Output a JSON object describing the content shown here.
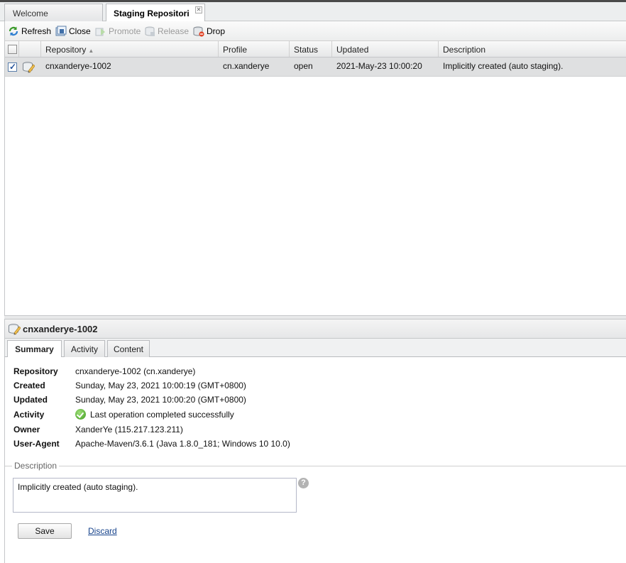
{
  "tabs": [
    {
      "label": "Welcome",
      "active": false
    },
    {
      "label": "Staging Repositori",
      "active": true
    }
  ],
  "toolbar": {
    "refresh": "Refresh",
    "close": "Close",
    "promote": "Promote",
    "release": "Release",
    "drop": "Drop"
  },
  "grid": {
    "columns": [
      "Repository",
      "Profile",
      "Status",
      "Updated",
      "Description"
    ],
    "sort_column": "Repository",
    "sort_direction": "ascending",
    "rows": [
      {
        "selected": true,
        "repository": "cnxanderye-1002",
        "profile": "cn.xanderye",
        "status": "open",
        "updated": "2021-May-23 10:00:20",
        "description": "Implicitly created (auto staging)."
      }
    ]
  },
  "detail": {
    "title": "cnxanderye-1002",
    "subtabs": [
      "Summary",
      "Activity",
      "Content"
    ],
    "active_subtab": "Summary",
    "properties": [
      {
        "label": "Repository",
        "value": "cnxanderye-1002 (cn.xanderye)"
      },
      {
        "label": "Created",
        "value": "Sunday, May 23, 2021 10:00:19 (GMT+0800)"
      },
      {
        "label": "Updated",
        "value": "Sunday, May 23, 2021 10:00:20 (GMT+0800)"
      },
      {
        "label": "Activity",
        "value": "Last operation completed successfully",
        "icon": "success-check-icon"
      },
      {
        "label": "Owner",
        "value": "XanderYe (115.217.123.211)"
      },
      {
        "label": "User-Agent",
        "value": "Apache-Maven/3.6.1 (Java 1.8.0_181; Windows 10 10.0)"
      }
    ],
    "description_legend": "Description",
    "description_value": "Implicitly created (auto staging).",
    "save_label": "Save",
    "discard_label": "Discard"
  },
  "colors": {
    "selected_row": "#dfe0e1",
    "link": "#15428b",
    "tab_bar_border": "#4a4a4a"
  }
}
